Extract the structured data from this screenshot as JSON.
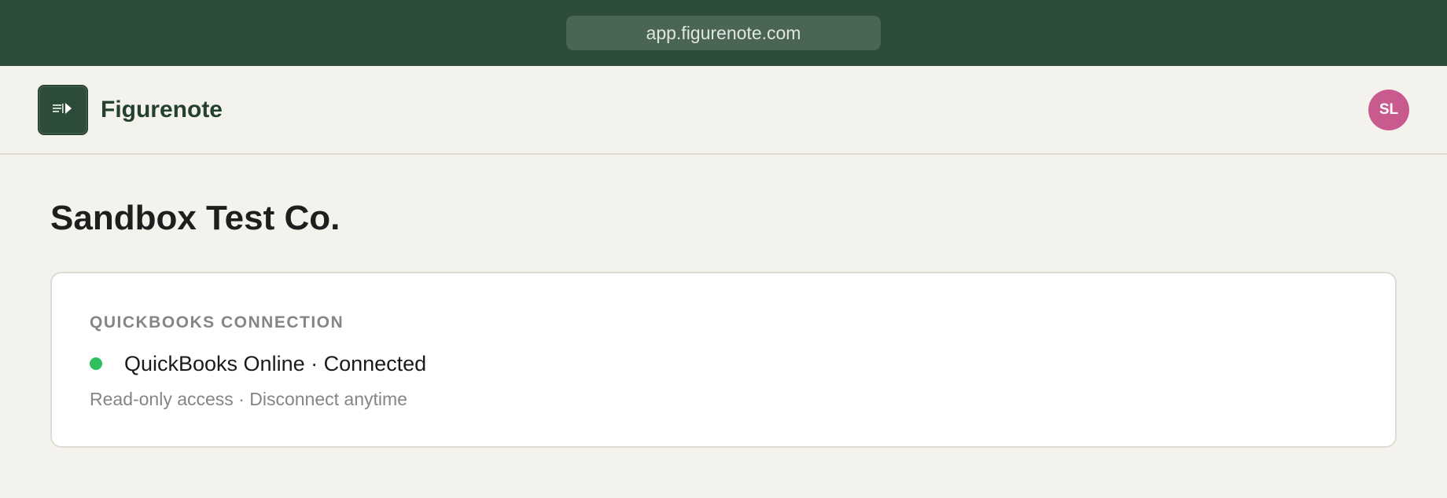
{
  "browser": {
    "url": "app.figurenote.com"
  },
  "header": {
    "brand_name": "Figurenote",
    "logo_icon": "document-play-icon",
    "avatar_initials": "SL",
    "avatar_color": "#c85a8e"
  },
  "main": {
    "title": "Sandbox Test Co.",
    "connection_card": {
      "heading": "QUICKBOOKS CONNECTION",
      "status_text": "QuickBooks Online · Connected",
      "status_color": "#2fbf5f",
      "subtext": "Read-only access · Disconnect anytime"
    }
  },
  "colors": {
    "brand_dark_green": "#2d4b39",
    "background": "#f4f2ed"
  }
}
